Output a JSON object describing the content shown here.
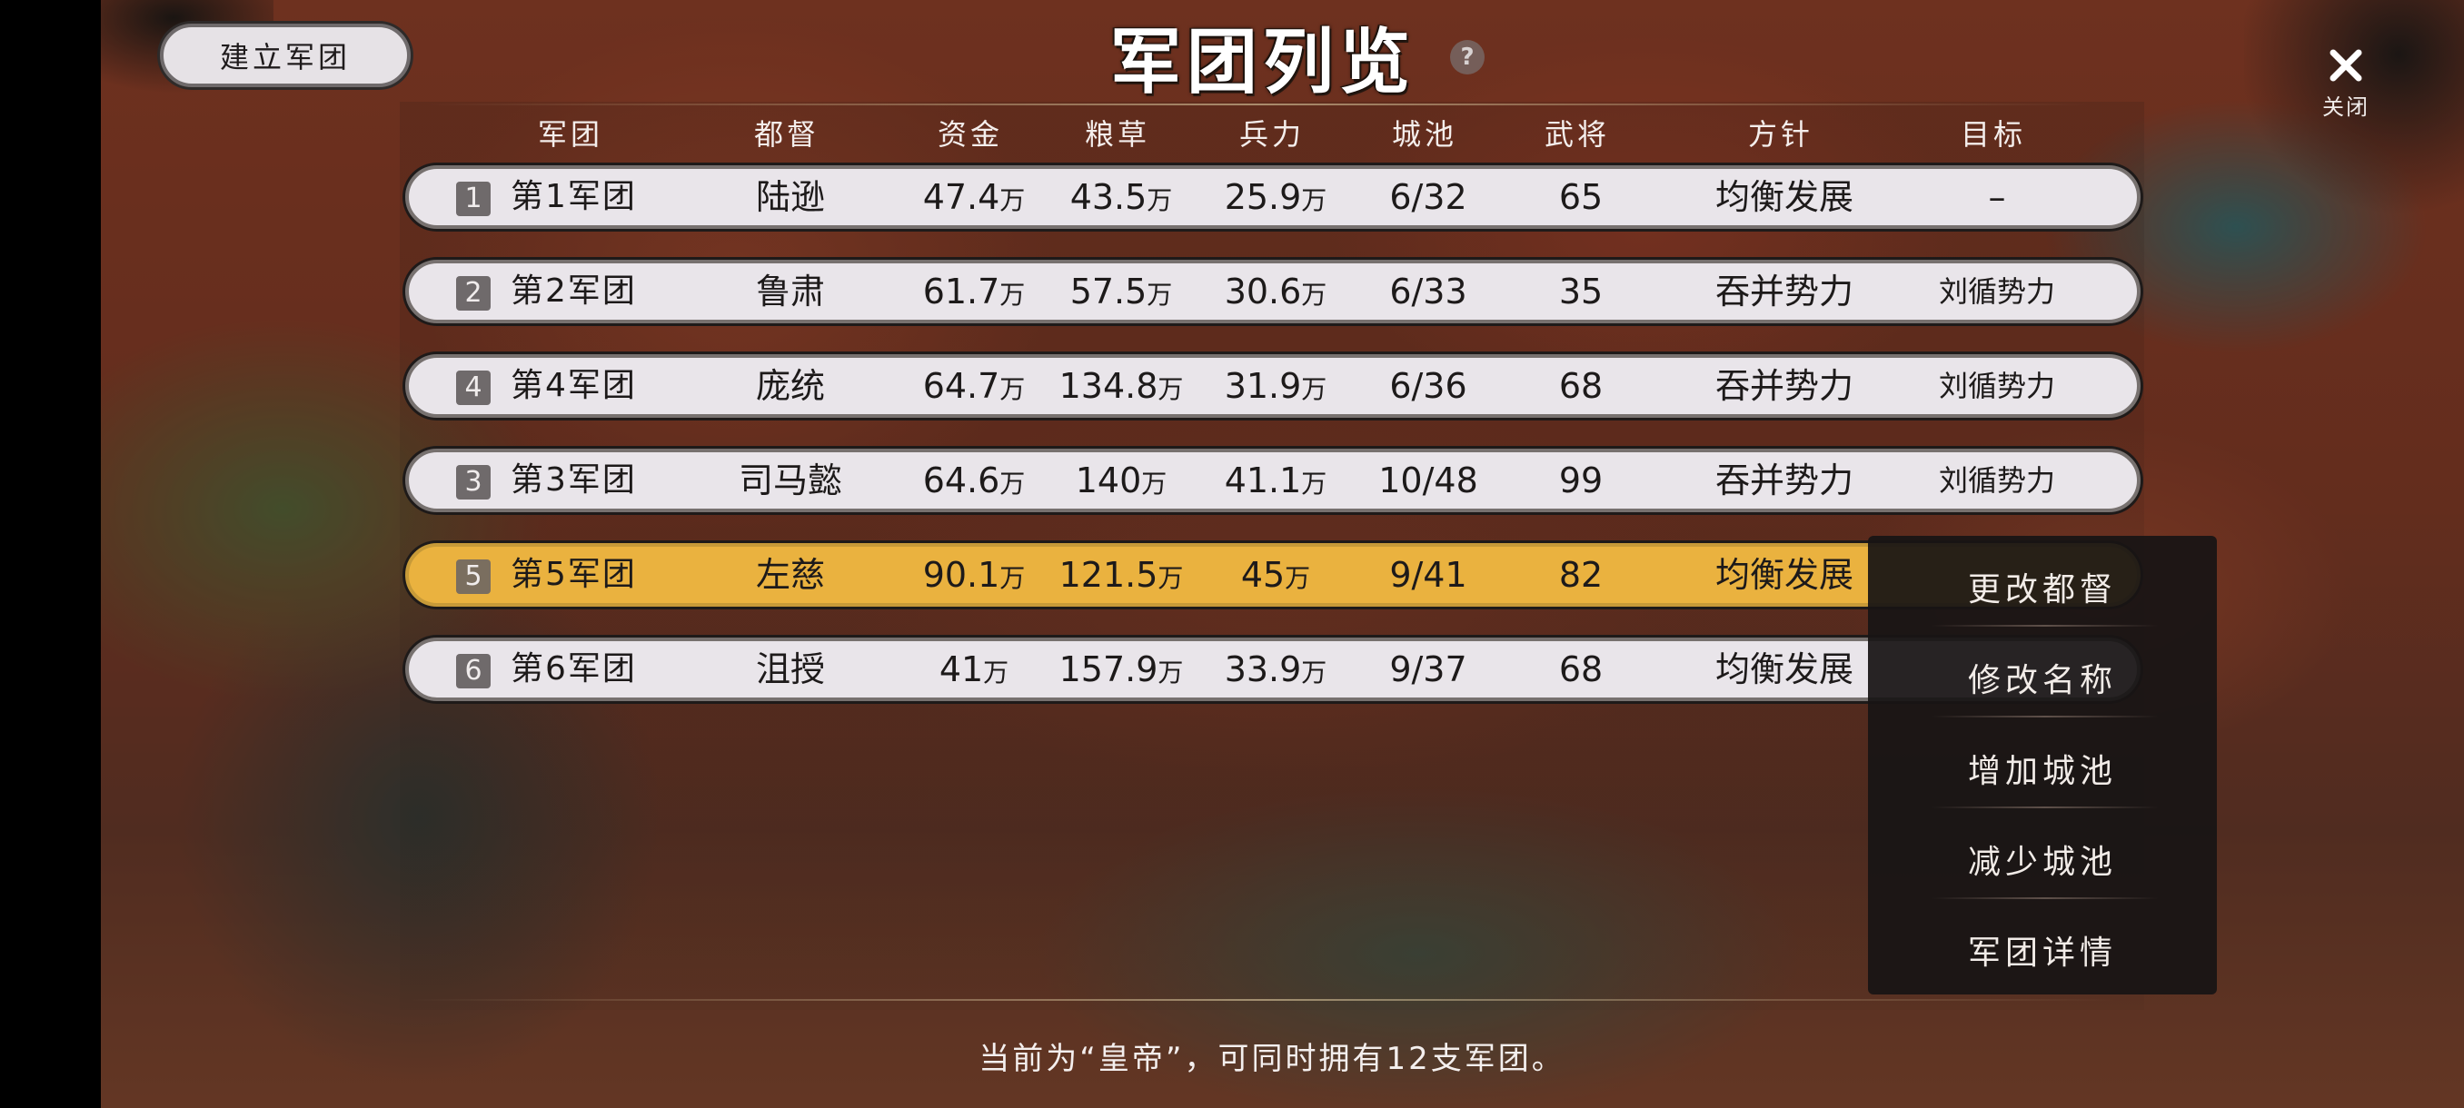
{
  "header": {
    "create_button": "建立军团",
    "title": "军团列览",
    "help_icon": "?",
    "close_label": "关闭"
  },
  "columns": [
    "军团",
    "都督",
    "资金",
    "粮草",
    "兵力",
    "城池",
    "武将",
    "方针",
    "目标"
  ],
  "rows": [
    {
      "num": "1",
      "name": "第1军团",
      "governor": "陆逊",
      "funds": "47.4",
      "grain": "43.5",
      "troops": "25.9",
      "cities": "6/32",
      "generals": "65",
      "policy": "均衡发展",
      "target": "–",
      "selected": false
    },
    {
      "num": "2",
      "name": "第2军团",
      "governor": "鲁肃",
      "funds": "61.7",
      "grain": "57.5",
      "troops": "30.6",
      "cities": "6/33",
      "generals": "35",
      "policy": "吞并势力",
      "target": "刘循势力",
      "selected": false
    },
    {
      "num": "4",
      "name": "第4军团",
      "governor": "庞统",
      "funds": "64.7",
      "grain": "134.8",
      "troops": "31.9",
      "cities": "6/36",
      "generals": "68",
      "policy": "吞并势力",
      "target": "刘循势力",
      "selected": false
    },
    {
      "num": "3",
      "name": "第3军团",
      "governor": "司马懿",
      "funds": "64.6",
      "grain": "140",
      "troops": "41.1",
      "cities": "10/48",
      "generals": "99",
      "policy": "吞并势力",
      "target": "刘循势力",
      "selected": false
    },
    {
      "num": "5",
      "name": "第5军团",
      "governor": "左慈",
      "funds": "90.1",
      "grain": "121.5",
      "troops": "45",
      "cities": "9/41",
      "generals": "82",
      "policy": "均衡发展",
      "target": "",
      "selected": true
    },
    {
      "num": "6",
      "name": "第6军团",
      "governor": "沮授",
      "funds": "41",
      "grain": "157.9",
      "troops": "33.9",
      "cities": "9/37",
      "generals": "68",
      "policy": "均衡发展",
      "target": "",
      "selected": false
    }
  ],
  "unit": "万",
  "menu": [
    "更改都督",
    "修改名称",
    "增加城池",
    "减少城池",
    "军团详情"
  ],
  "footer": "当前为“皇帝”，可同时拥有12支军团。",
  "colors": {
    "selected_row": "#eab23f",
    "row": "#e9e5ea",
    "menu_bg": "#181414"
  },
  "icons": [
    "close-icon",
    "help-icon"
  ]
}
